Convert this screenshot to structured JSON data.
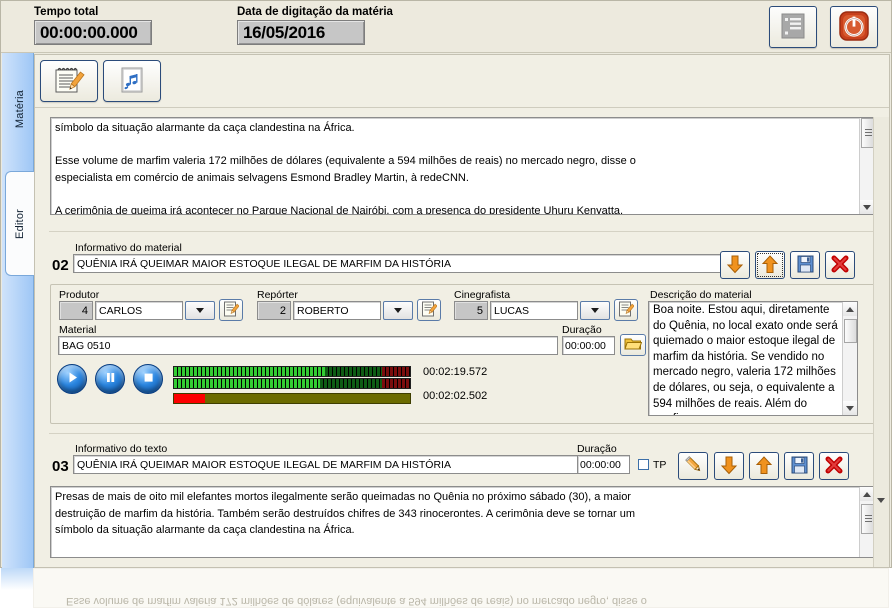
{
  "header": {
    "tempo_label": "Tempo total",
    "tempo_value": "00:00:00.000",
    "data_label": "Data de digitação da matéria",
    "data_value": "16/05/2016",
    "buttons": [
      {
        "name": "list-report-button",
        "icon": "list-icon"
      },
      {
        "name": "exit-button",
        "icon": "power-icon"
      }
    ]
  },
  "rail": {
    "tabs": [
      {
        "label": "Matéria",
        "active": false
      },
      {
        "label": "Editor",
        "active": true
      }
    ]
  },
  "toolbar": {
    "buttons": [
      {
        "name": "edit-note-button",
        "icon": "notepad-pencil-icon"
      },
      {
        "name": "audio-script-button",
        "icon": "music-document-icon"
      }
    ]
  },
  "top_editor": {
    "text": "símbolo da situação alarmante da caça clandestina na África.\n\nEsse volume de marfim valeria 172 milhões de dólares (equivalente a 594 milhões de reais) no mercado negro, disse o\nespecialista em comércio de animais selvagens Esmond Bradley Martin, à redeCNN.\n\nA cerimônia de queima irá acontecer no Parque Nacional de Nairóbi, com a presença do presidente Uhuru Kenyatta,\nchefes de estado de outros países da África, oficiais da Organização das Nações Unidas e dos Estados Unidos, além de"
  },
  "material_block": {
    "seq": "02",
    "info_label": "Informativo do material",
    "info_value": "QUÊNIA IRÁ QUEIMAR MAIOR ESTOQUE ILEGAL DE MARFIM DA HISTÓRIA",
    "actions": [
      {
        "name": "move-down-button",
        "icon": "arrow-down-icon"
      },
      {
        "name": "move-up-button",
        "icon": "arrow-up-icon"
      },
      {
        "name": "save-material-button",
        "icon": "floppy-save-icon"
      },
      {
        "name": "delete-material-button",
        "icon": "red-x-icon"
      }
    ],
    "produtor_label": "Produtor",
    "produtor_code": "4",
    "produtor_name": "CARLOS",
    "reporter_label": "Repórter",
    "reporter_code": "2",
    "reporter_name": "ROBERTO",
    "cinegrafista_label": "Cinegrafista",
    "cinegrafista_code": "5",
    "cinegrafista_name": "LUCAS",
    "material_label": "Material",
    "material_value": "BAG 0510",
    "duracao_label": "Duração",
    "duracao_value": "00:00:00",
    "time_total": "00:02:19.572",
    "time_current": "00:02:02.502",
    "descricao_label": "Descrição do material",
    "descricao_text": "Boa noite. Estou aqui, diretamente do Quênia, no local exato onde será quiemado o maior estoque ilegal de marfim da história. Se vendido no mercado negro, valeria 172 milhões de dólares, ou seja, o equivalente a 594 milhões de reais. Além do marfim",
    "transport": [
      {
        "name": "play-button",
        "icon": "play-icon"
      },
      {
        "name": "pause-button",
        "icon": "pause-icon"
      },
      {
        "name": "stop-button",
        "icon": "stop-icon"
      }
    ],
    "browse_button": {
      "name": "browse-material-button",
      "icon": "open-folder-icon"
    }
  },
  "text_block": {
    "seq": "03",
    "info_label": "Informativo do texto",
    "info_value": "QUÊNIA IRÁ QUEIMAR MAIOR ESTOQUE ILEGAL DE MARFIM DA HISTÓRIA",
    "duracao_label": "Duração",
    "duracao_value": "00:00:00",
    "tp_label": "TP",
    "actions": [
      {
        "name": "edit-text-button",
        "icon": "pencil-icon"
      },
      {
        "name": "move-down-button",
        "icon": "arrow-down-icon"
      },
      {
        "name": "move-up-button",
        "icon": "arrow-up-icon"
      },
      {
        "name": "save-text-button",
        "icon": "floppy-save-icon"
      },
      {
        "name": "delete-text-button",
        "icon": "red-x-icon"
      }
    ],
    "body_text": "Presas de mais de oito mil elefantes mortos ilegalmente serão queimadas no Quênia no próximo sábado (30), a maior\ndestruição de marfim da história. Também serão destruídos chifres de 343 rinocerontes. A cerimônia deve se tornar um\nsímbolo da situação alarmante da caça clandestina na África.\n\nEsse volume de marfim valeria 172 milhões de dólares (equivalente a 594 milhões de reais) no mercado negro, disse o"
  },
  "reflection": {
    "text": "Esse volume de marfim valeria 172 milhões de dólares (equivalente a 594 milhões de reais) no mercado negro, disse o"
  },
  "colors": {
    "window_bg": "#eceade",
    "accent_blue": "#2b4b7a",
    "rail_blue": "#9fc7f6",
    "vu_green": "#33cc33",
    "vu_dark_green": "#0e5c14",
    "vu_red": "#7a0d0d",
    "progress_red": "#fd0000",
    "progress_olive": "#6b6b00",
    "arrow_orange": "#f29b1d"
  }
}
